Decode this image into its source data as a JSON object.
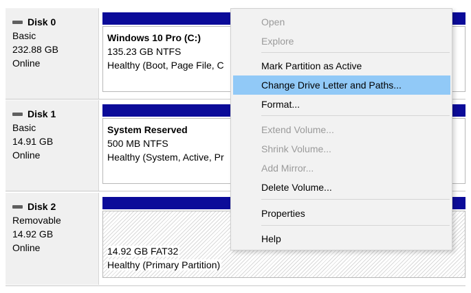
{
  "disks": [
    {
      "name": "Disk 0",
      "type": "Basic",
      "size": "232.88 GB",
      "status": "Online",
      "partition": {
        "title": "Windows 10 Pro  (C:)",
        "fs": "135.23 GB NTFS",
        "health": "Healthy (Boot, Page File, C"
      }
    },
    {
      "name": "Disk 1",
      "type": "Basic",
      "size": "14.91 GB",
      "status": "Online",
      "partition": {
        "title": "System Reserved",
        "fs": "500 MB NTFS",
        "health": "Healthy (System, Active, Pr"
      }
    },
    {
      "name": "Disk 2",
      "type": "Removable",
      "size": "14.92 GB",
      "status": "Online",
      "partition": {
        "fs": "14.92 GB FAT32",
        "health": "Healthy (Primary Partition)"
      }
    }
  ],
  "context_menu": {
    "items": [
      {
        "label": "Open",
        "enabled": false
      },
      {
        "label": "Explore",
        "enabled": false
      },
      {
        "label": "Mark Partition as Active",
        "enabled": true
      },
      {
        "label": "Change Drive Letter and Paths...",
        "enabled": true,
        "highlighted": true
      },
      {
        "label": "Format...",
        "enabled": true
      },
      {
        "label": "Extend Volume...",
        "enabled": false
      },
      {
        "label": "Shrink Volume...",
        "enabled": false
      },
      {
        "label": "Add Mirror...",
        "enabled": false
      },
      {
        "label": "Delete Volume...",
        "enabled": true
      },
      {
        "label": "Properties",
        "enabled": true
      },
      {
        "label": "Help",
        "enabled": true
      }
    ]
  },
  "colors": {
    "partition_bar": "#0b0b99",
    "menu_highlight": "#91c9f7",
    "disabled_text": "#9a9a9a"
  }
}
